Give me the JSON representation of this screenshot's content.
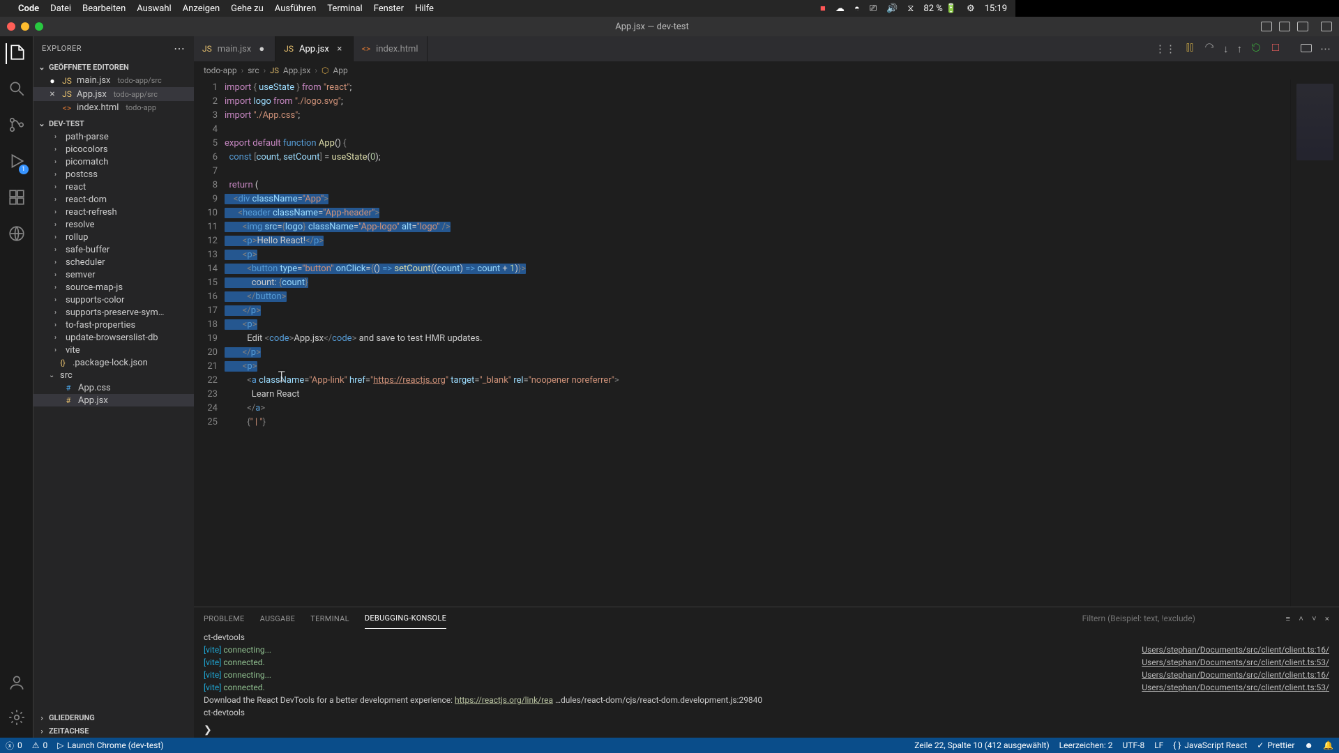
{
  "menubar": {
    "app": "Code",
    "items": [
      "Datei",
      "Bearbeiten",
      "Auswahl",
      "Anzeigen",
      "Gehe zu",
      "Ausführen",
      "Terminal",
      "Fenster",
      "Hilfe"
    ],
    "battery": "82 %",
    "time": "15:19"
  },
  "window": {
    "title": "App.jsx — dev-test"
  },
  "explorer": {
    "title": "EXPLORER",
    "sections": {
      "open_editors": {
        "label": "GEÖFFNETE EDITOREN",
        "items": [
          {
            "modified": "●",
            "name": "main.jsx",
            "path": "todo-app/src"
          },
          {
            "modified": "×",
            "name": "App.jsx",
            "path": "todo-app/src",
            "active": true
          },
          {
            "modified": "",
            "name": "index.html",
            "path": "todo-app"
          }
        ]
      },
      "project": {
        "label": "DEV-TEST",
        "folders": [
          "path-parse",
          "picocolors",
          "picomatch",
          "postcss",
          "react",
          "react-dom",
          "react-refresh",
          "resolve",
          "rollup",
          "safe-buffer",
          "scheduler",
          "semver",
          "source-map-js",
          "supports-color",
          "supports-preserve-sym…",
          "to-fast-properties",
          "update-browserslist-db",
          "vite"
        ],
        "files": [
          {
            "name": ".package-lock.json",
            "icon": "{}"
          }
        ],
        "src": {
          "name": "src",
          "files": [
            "App.css",
            "App.jsx"
          ]
        }
      },
      "outline": {
        "label": "GLIEDERUNG"
      },
      "timeline": {
        "label": "ZEITACHSE"
      }
    }
  },
  "activity": {
    "debug_badge": "1"
  },
  "tabs": [
    {
      "name": "main.jsx",
      "modified": true
    },
    {
      "name": "App.jsx",
      "active": true,
      "close": true
    },
    {
      "name": "index.html"
    }
  ],
  "breadcrumb": [
    "todo-app",
    "src",
    "App.jsx",
    "App"
  ],
  "panel": {
    "tabs": [
      "PROBLEME",
      "AUSGABE",
      "TERMINAL",
      "DEBUGGING-KONSOLE"
    ],
    "active": 3,
    "filter_placeholder": "Filtern (Beispiel: text, !exclude)",
    "lines": [
      {
        "l": "ct-devtools",
        "r": ""
      },
      {
        "l": "[vite] connecting...",
        "r": "Users/stephan/Documents/src/client/client.ts:16/"
      },
      {
        "l": "[vite] connected.",
        "r": "Users/stephan/Documents/src/client/client.ts:53/"
      },
      {
        "l": "[vite] connecting...",
        "r": "Users/stephan/Documents/src/client/client.ts:16/"
      },
      {
        "l": "[vite] connected.",
        "r": "Users/stephan/Documents/src/client/client.ts:53/"
      },
      {
        "l": "Download the React DevTools for a better development experience: https://reactjs.org/link/rea …dules/react-dom/cjs/react-dom.development.js:29840",
        "r": ""
      },
      {
        "l": "ct-devtools",
        "r": ""
      }
    ]
  },
  "prompt": "❯",
  "status": {
    "errors": "0",
    "warnings": "0",
    "launch": "Launch Chrome (dev-test)",
    "pos": "Zeile 22, Spalte 10 (412 ausgewählt)",
    "spaces": "Leerzeichen: 2",
    "enc": "UTF-8",
    "eol": "LF",
    "lang": "JavaScript React",
    "prettier": "Prettier"
  },
  "chart_data": null
}
